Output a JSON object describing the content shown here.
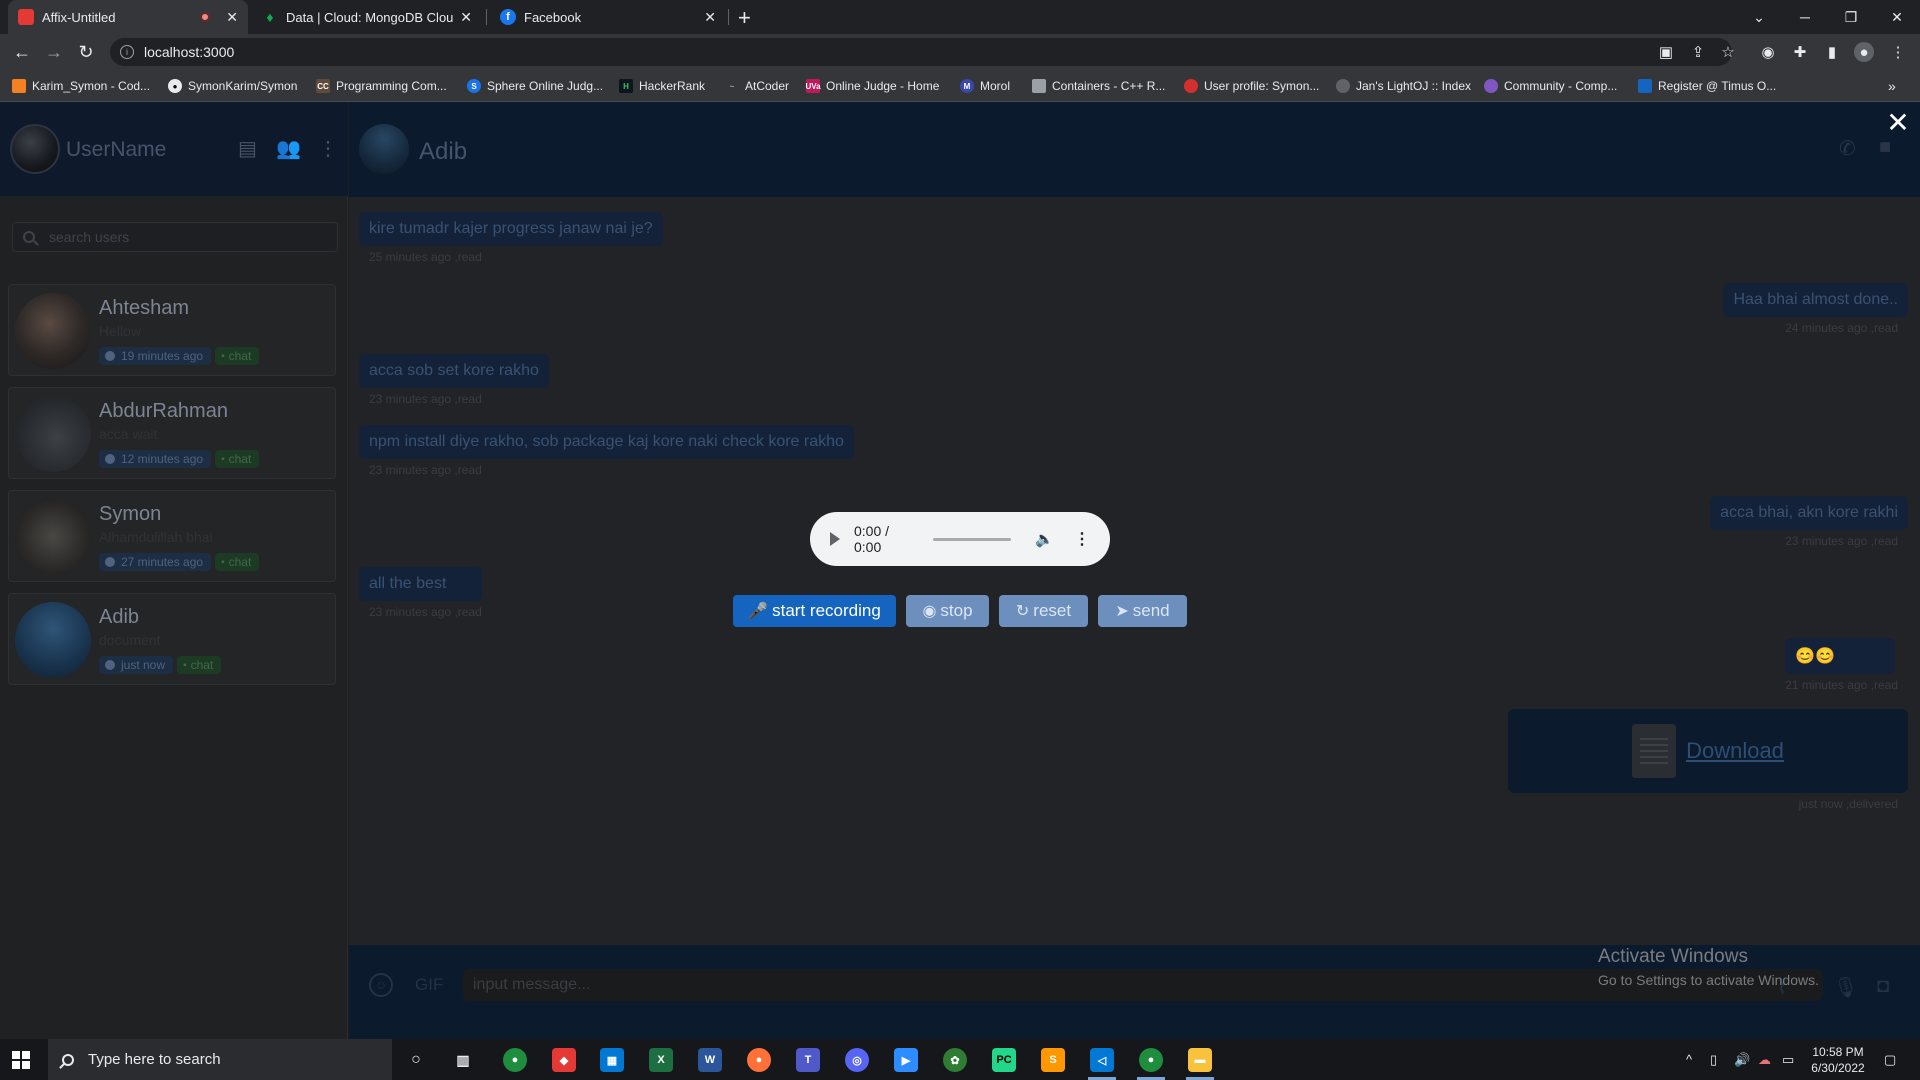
{
  "browser": {
    "tabs": [
      {
        "title": "Affix-Untitled",
        "active": true,
        "favicon_color": "#e53935"
      },
      {
        "title": "Data | Cloud: MongoDB Cloud",
        "active": false,
        "favicon_color": "#13aa52"
      },
      {
        "title": "Facebook",
        "active": false,
        "favicon_color": "#1877f2"
      }
    ],
    "url": "localhost:3000",
    "bookmarks": [
      "Karim_Symon - Cod...",
      "SymonKarim/Symon",
      "Programming Com...",
      "Sphere Online Judg...",
      "HackerRank",
      "AtCoder",
      "Online Judge - Home",
      "Morol",
      "Containers - C++ R...",
      "User profile: Symon...",
      "Jan's LightOJ :: Index",
      "Community - Comp...",
      "Register @ Timus O..."
    ]
  },
  "sidebar": {
    "username": "UserName",
    "search_placeholder": "search users",
    "contacts": [
      {
        "name": "Ahtesham",
        "last_message": "Hellow",
        "time": "19 minutes ago",
        "chat_label": "chat"
      },
      {
        "name": "AbdurRahman",
        "last_message": "acca wait",
        "time": "12 minutes ago",
        "chat_label": "chat"
      },
      {
        "name": "Symon",
        "last_message": "Alhamdulillah bhai",
        "time": "27 minutes ago",
        "chat_label": "chat"
      },
      {
        "name": "Adib",
        "last_message": "document",
        "time": "just now",
        "chat_label": "chat"
      }
    ]
  },
  "chat": {
    "contact_name": "Adib",
    "messages": [
      {
        "side": "left",
        "text": "kire tumadr kajer progress janaw nai je?",
        "meta": "25 minutes ago ,read"
      },
      {
        "side": "right",
        "text": "Haa bhai almost done..",
        "meta": "24 minutes ago ,read"
      },
      {
        "side": "left",
        "text": "acca sob set kore rakho",
        "meta": "23 minutes ago ,read"
      },
      {
        "side": "left",
        "text": "npm install diye rakho, sob package kaj kore naki check kore rakho",
        "meta": "23 minutes ago ,read"
      },
      {
        "side": "right",
        "text": "acca bhai, akn kore rakhi",
        "meta": "23 minutes ago ,read"
      },
      {
        "side": "left",
        "text": "all the best",
        "meta": "23 minutes ago ,read"
      },
      {
        "side": "right",
        "text": "😊😊",
        "meta": "21 minutes ago ,read"
      }
    ],
    "download": {
      "label": "Download",
      "meta": "just now ,delivered"
    },
    "input_placeholder": "input message...",
    "gif_label": "GIF"
  },
  "recorder": {
    "time_display": "0:00 / 0:00",
    "start_label": "start recording",
    "stop_label": "stop",
    "reset_label": "reset",
    "send_label": "send"
  },
  "watermark": {
    "line1": "Activate Windows",
    "line2": "Go to Settings to activate Windows."
  },
  "taskbar": {
    "search_placeholder": "Type here to search",
    "time": "10:58 PM",
    "date": "6/30/2022"
  }
}
